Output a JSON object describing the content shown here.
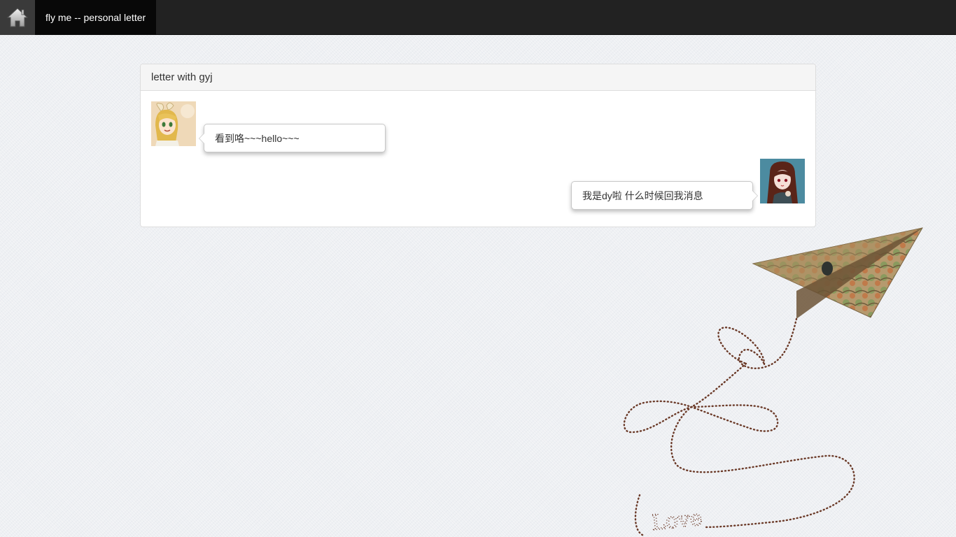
{
  "navbar": {
    "home_icon": "home-icon",
    "brand": "fly me -- personal letter"
  },
  "panel": {
    "title": "letter with gyj"
  },
  "messages": [
    {
      "side": "left",
      "avatar": "blonde-girl-avatar",
      "text": "看到咯~~~hello~~~"
    },
    {
      "side": "right",
      "avatar": "dark-hair-girl-avatar",
      "text": "我是dy啦 什么时候回我消息"
    }
  ],
  "decoration": {
    "illustration": "paper-plane-heart-trail",
    "word": "Love"
  },
  "colors": {
    "navbar": "#222222",
    "brand_bg": "#080808",
    "trail": "#6b3a28"
  }
}
